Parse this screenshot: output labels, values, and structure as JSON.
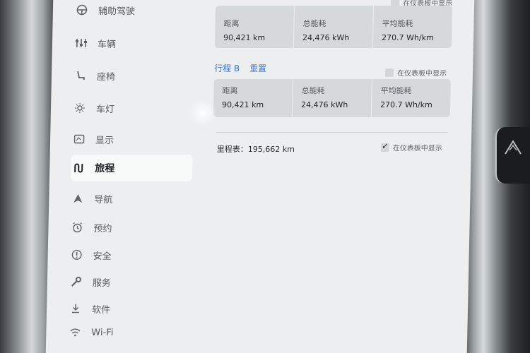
{
  "sidebar": {
    "items": [
      {
        "label": "辅助驾驶",
        "icon": "steering-wheel-icon"
      },
      {
        "label": "车辆",
        "icon": "sliders-icon"
      },
      {
        "label": "座椅",
        "icon": "seat-icon"
      },
      {
        "label": "车灯",
        "icon": "light-icon"
      },
      {
        "label": "显示",
        "icon": "display-icon"
      },
      {
        "label": "旅程",
        "icon": "trips-icon"
      },
      {
        "label": "导航",
        "icon": "navigation-icon"
      },
      {
        "label": "预约",
        "icon": "alarm-clock-icon"
      },
      {
        "label": "安全",
        "icon": "warning-icon"
      },
      {
        "label": "服务",
        "icon": "wrench-icon"
      },
      {
        "label": "软件",
        "icon": "download-icon"
      },
      {
        "label": "Wi-Fi",
        "icon": "wifi-icon"
      }
    ],
    "active_index": 5
  },
  "trip_a": {
    "show_on_dashboard_label": "在仪表板中显示",
    "stats": [
      {
        "label": "距离",
        "value": "90,421 km"
      },
      {
        "label": "总能耗",
        "value": "24,476 kWh"
      },
      {
        "label": "平均能耗",
        "value": "270.7 Wh/km"
      }
    ]
  },
  "trip_b": {
    "title": "行程 B",
    "reset_label": "重置",
    "show_on_dashboard_label": "在仪表板中显示",
    "show_on_dashboard_checked": false,
    "stats": [
      {
        "label": "距离",
        "value": "90,421 km"
      },
      {
        "label": "总能耗",
        "value": "24,476 kWh"
      },
      {
        "label": "平均能耗",
        "value": "270.7 Wh/km"
      }
    ]
  },
  "odometer": {
    "text": "里程表：195,662 km",
    "show_on_dashboard_label": "在仪表板中显示",
    "show_on_dashboard_checked": true
  },
  "colors": {
    "accent": "#3a7bd5",
    "screen_bg": "#eceeef",
    "stat_bg": "#d6d9dc"
  }
}
